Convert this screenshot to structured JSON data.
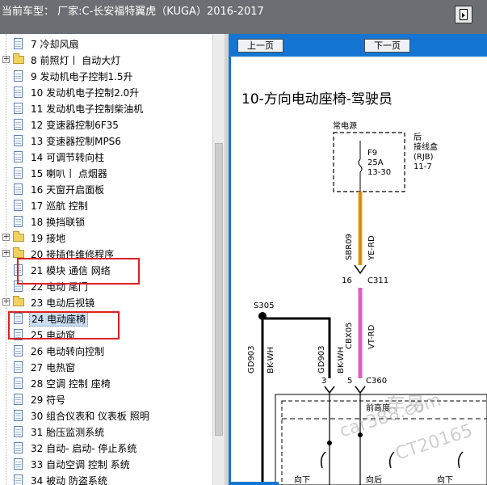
{
  "window": {
    "title": "当前车型：  厂家:C-长安福特翼虎（KUGA）2016-2017"
  },
  "tree": {
    "items": [
      {
        "label": "7 冷却风扇",
        "type": "doc"
      },
      {
        "label": "8 前照灯丨 自动大灯",
        "type": "folder"
      },
      {
        "label": "9 发动机电子控制1.5升",
        "type": "doc"
      },
      {
        "label": "10 发动机电子控制2.0升",
        "type": "doc"
      },
      {
        "label": "11 发动机电子控制柴油机",
        "type": "doc"
      },
      {
        "label": "12 变速器控制6F35",
        "type": "doc"
      },
      {
        "label": "13 变速器控制MPS6",
        "type": "doc"
      },
      {
        "label": "14 可调节转向柱",
        "type": "doc"
      },
      {
        "label": "15 喇叭丨 点烟器",
        "type": "doc"
      },
      {
        "label": "16 天窗开启面板",
        "type": "doc"
      },
      {
        "label": "17 巡航 控制",
        "type": "doc"
      },
      {
        "label": "18 换挡联锁",
        "type": "doc"
      },
      {
        "label": "19 接地",
        "type": "folder"
      },
      {
        "label": "20 接插件维修程序",
        "type": "folder"
      },
      {
        "label": "21 模块 通信 网络",
        "type": "doc"
      },
      {
        "label": "22 电动 尾门",
        "type": "doc"
      },
      {
        "label": "23 电动后视镜",
        "type": "folder"
      },
      {
        "label": "24 电动座椅",
        "type": "doc",
        "selected": true
      },
      {
        "label": "25 电动窗",
        "type": "doc"
      },
      {
        "label": "26 电动转向控制",
        "type": "doc"
      },
      {
        "label": "27 电热窗",
        "type": "doc"
      },
      {
        "label": "28 空调 控制 座椅",
        "type": "doc"
      },
      {
        "label": "29 符号",
        "type": "doc"
      },
      {
        "label": "30 组合仪表和 仪表板 照明",
        "type": "doc"
      },
      {
        "label": "31 胎压监测系统",
        "type": "doc"
      },
      {
        "label": "32 自动- 启动- 停止系统",
        "type": "doc"
      },
      {
        "label": "33 自动空调 控制 系统",
        "type": "doc"
      },
      {
        "label": "34 被动 防盗系统",
        "type": "doc"
      }
    ],
    "expander_glyph": "+"
  },
  "nav": {
    "prev_label": "上一页",
    "next_label": "下一页"
  },
  "document": {
    "title": "10-方向电动座椅-驾驶员",
    "diagram": {
      "power_label": "常电源",
      "fuse_name": "F9",
      "fuse_rating": "25A",
      "fuse_pins": "13-30",
      "junction_line1": "后",
      "junction_line2": "接线盒",
      "junction_line3": "(RJB)",
      "junction_line4": "11-7",
      "wire1_code": "SBR09",
      "wire1_color": "YE-RD",
      "conn1_pin": "16",
      "conn1_name": "C311",
      "splice": "S305",
      "wire2_code": "CBX05",
      "wire2_color": "VT-RD",
      "gnd1_code": "GD903",
      "gnd1_color": "BK-WH",
      "gnd2_code": "GD903",
      "gnd2_color": "BK-WH",
      "conn2_pin_a": "3",
      "conn2_pin_b": "5",
      "conn2_name": "C360",
      "seat_label": "前高度",
      "down1": "向下",
      "down2": "向下",
      "back": "向后"
    },
    "watermarks": [
      "车易",
      "car388.com",
      "CT20165"
    ]
  },
  "colors": {
    "nav_blue": "#1476d2",
    "highlight_red": "#e02020",
    "wire_orange": "#f0a020",
    "wire_pink": "#e060c0"
  }
}
